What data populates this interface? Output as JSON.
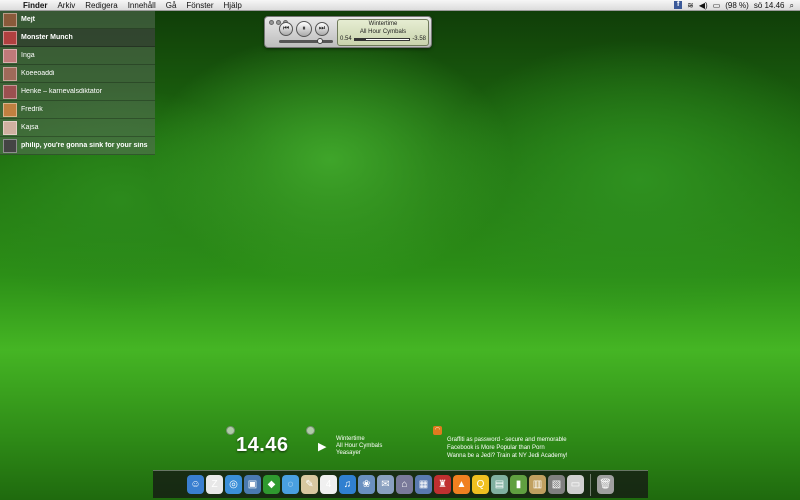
{
  "menubar": {
    "app_name": "Finder",
    "items": [
      "Arkiv",
      "Redigera",
      "Innehåll",
      "Gå",
      "Fönster",
      "Hjälp"
    ],
    "status": {
      "battery": "(98 %)",
      "clock": "sö 14.46",
      "icons": [
        "facebook-icon",
        "wifi-icon",
        "volume-icon",
        "battery-icon",
        "spotlight-icon"
      ]
    }
  },
  "chat": {
    "contacts": [
      {
        "name": "Mejt",
        "avatar_color": "#8a5a3a",
        "selected": false,
        "bold": true
      },
      {
        "name": "Monster Munch",
        "avatar_color": "#b04040",
        "selected": true,
        "bold": true
      },
      {
        "name": "Inga",
        "avatar_color": "#c07a7a",
        "selected": false,
        "bold": false
      },
      {
        "name": "Koeeoaddi",
        "avatar_color": "#a06a5a",
        "selected": false,
        "bold": false
      },
      {
        "name": "Henke – karnevalsdiktator",
        "avatar_color": "#9a5050",
        "selected": false,
        "bold": false
      },
      {
        "name": "Fredrik",
        "avatar_color": "#c08040",
        "selected": false,
        "bold": false
      },
      {
        "name": "Kajsa",
        "avatar_color": "#d0b0a0",
        "selected": false,
        "bold": false
      },
      {
        "name": "philip, you're gonna sink for your sins",
        "avatar_color": "#444444",
        "selected": false,
        "bold": true
      }
    ]
  },
  "player": {
    "buttons": {
      "previous": "⏮",
      "play_pause": "⏸",
      "next": "⏭"
    },
    "track_title": "Wintertime",
    "artist": "All Hour Cymbals",
    "elapsed": "0.54",
    "remaining": "-3.58",
    "progress": 0.2,
    "volume": 0.75
  },
  "widgets": {
    "clock": {
      "time": "14.46"
    },
    "music": {
      "play_symbol": "▶",
      "lines": [
        "Wintertime",
        "All Hour Cymbals",
        "Yeasayer"
      ]
    },
    "rss": {
      "lines": [
        "Graffiti as password - secure and memorable",
        "Facebook is More Popular than Porn",
        "Wanna be a Jedi? Train at NY Jedi Academy!"
      ]
    }
  },
  "dock": {
    "apps": [
      {
        "name": "finder-icon",
        "glyph": "☺",
        "color": "#3a7fd0"
      },
      {
        "name": "calendar-sync-icon",
        "glyph": "Z",
        "color": "#e8e8e8"
      },
      {
        "name": "safari-icon",
        "glyph": "◎",
        "color": "#3b8fd8"
      },
      {
        "name": "photo-icon",
        "glyph": "▣",
        "color": "#4a7ab0"
      },
      {
        "name": "adium-icon",
        "glyph": "◆",
        "color": "#2f9a2f"
      },
      {
        "name": "ichat-icon",
        "glyph": "◌",
        "color": "#4aa0e0"
      },
      {
        "name": "script-editor-icon",
        "glyph": "✎",
        "color": "#d8c8a0"
      },
      {
        "name": "ical-icon",
        "glyph": "4",
        "color": "#f0f0f0"
      },
      {
        "name": "itunes-icon",
        "glyph": "♫",
        "color": "#3080d0"
      },
      {
        "name": "iphoto-icon",
        "glyph": "❀",
        "color": "#6a90c0"
      },
      {
        "name": "mail-stamp-icon",
        "glyph": "✉",
        "color": "#8aa0c0"
      },
      {
        "name": "network-icon",
        "glyph": "⌂",
        "color": "#7a7a9a"
      },
      {
        "name": "spaces-icon",
        "glyph": "▦",
        "color": "#5a7ab0"
      },
      {
        "name": "chair-icon",
        "glyph": "♜",
        "color": "#c03030"
      },
      {
        "name": "vlc-icon",
        "glyph": "▲",
        "color": "#f08020"
      },
      {
        "name": "search-app-icon",
        "glyph": "Q",
        "color": "#f0c020"
      },
      {
        "name": "preview-icon",
        "glyph": "▤",
        "color": "#80b0a0"
      },
      {
        "name": "terminal-icon",
        "glyph": "▮",
        "color": "#60a040"
      },
      {
        "name": "archive-icon",
        "glyph": "▥",
        "color": "#c0a060"
      },
      {
        "name": "photos-stack-icon",
        "glyph": "▧",
        "color": "#808080"
      },
      {
        "name": "frame-icon",
        "glyph": "▭",
        "color": "#d0d0d0"
      },
      {
        "name": "trash-icon",
        "glyph": "🗑",
        "color": "#a0a0a0"
      }
    ]
  }
}
